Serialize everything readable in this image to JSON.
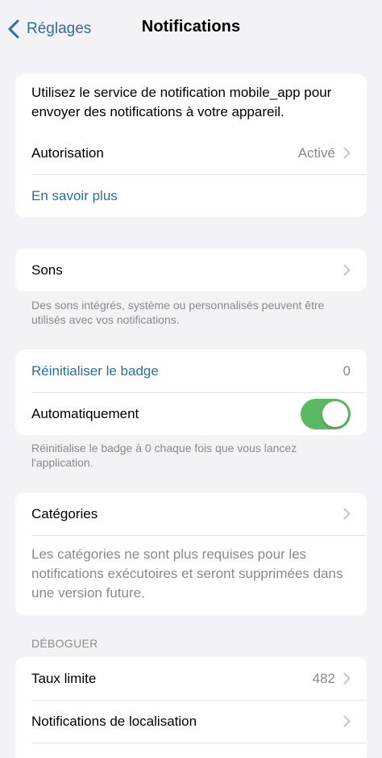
{
  "nav": {
    "back_label": "Réglages",
    "title": "Notifications"
  },
  "intro_card": {
    "description": "Utilisez le service de notification mobile_app pour envoyer des notifications à votre appareil.",
    "authorization_label": "Autorisation",
    "authorization_value": "Activé",
    "learn_more_label": "En savoir plus"
  },
  "sounds_card": {
    "label": "Sons",
    "footnote": "Des sons intégrés, système ou personnalisés peuvent être utilisés avec vos notifications."
  },
  "badge_card": {
    "reset_label": "Réinitialiser le badge",
    "badge_count": "0",
    "auto_label": "Automatiquement",
    "auto_enabled": true,
    "footnote": "Réinitialise le badge à 0 chaque fois que vous lancez l'application."
  },
  "categories_card": {
    "label": "Catégories",
    "description": "Les catégories ne sont plus requises pour les notifications exécutoires et seront supprimées dans une version future."
  },
  "debug_section": {
    "header": "DÉBOGUER",
    "rate_limit_label": "Taux limite",
    "rate_limit_value": "482",
    "location_label": "Notifications de localisation"
  },
  "colors": {
    "background": "#f2f2f7",
    "accent": "#2c6f9e",
    "toggle_on": "#5bb865",
    "secondary_text": "#8a8a8e"
  }
}
